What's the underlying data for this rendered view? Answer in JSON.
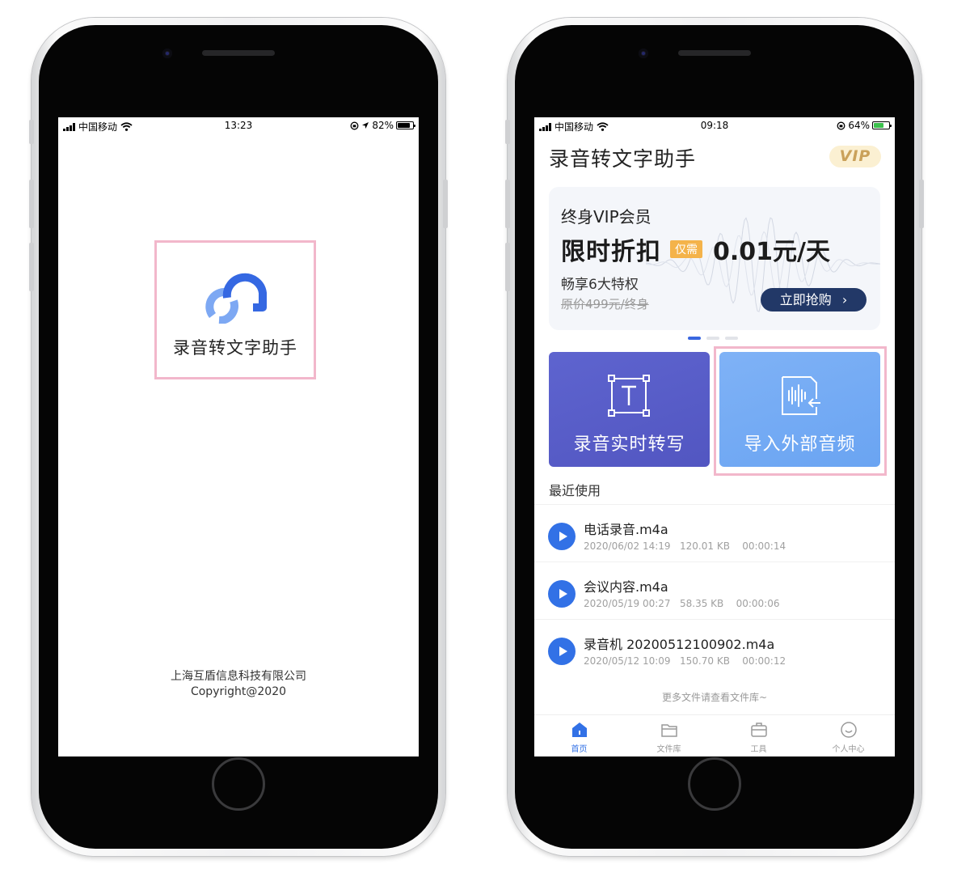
{
  "left_screen": {
    "status": {
      "carrier": "中国移动",
      "time": "13:23",
      "battery": "82%",
      "battery_level": 0.82
    },
    "app_name": "录音转文字助手",
    "company": "上海互盾信息科技有限公司",
    "copyright": "Copyright@2020"
  },
  "right_screen": {
    "status": {
      "carrier": "中国移动",
      "time": "09:18",
      "battery": "64%",
      "battery_level": 0.64
    },
    "header": {
      "title": "录音转文字助手",
      "vip_badge": "VIP"
    },
    "banner": {
      "title": "终身VIP会员",
      "discount": "限时折扣",
      "tag": "仅需",
      "price": "0.01元/天",
      "subtitle": "畅享6大特权",
      "original_price": "原价499元/终身",
      "buy_button": "立即抢购"
    },
    "carousel": {
      "total": 3,
      "active_index": 0
    },
    "cards": {
      "realtime": "录音实时转写",
      "import": "导入外部音频"
    },
    "recent": {
      "title": "最近使用",
      "items": [
        {
          "name": "电话录音.m4a",
          "date": "2020/06/02 14:19",
          "size": "120.01 KB",
          "duration": "00:00:14"
        },
        {
          "name": "会议内容.m4a",
          "date": "2020/05/19 00:27",
          "size": "58.35 KB",
          "duration": "00:00:06"
        },
        {
          "name": "录音机 20200512100902.m4a",
          "date": "2020/05/12 10:09",
          "size": "150.70 KB",
          "duration": "00:00:12"
        }
      ],
      "more": "更多文件请查看文件库~"
    },
    "tabs": [
      {
        "label": "首页",
        "icon": "home-icon",
        "active": true
      },
      {
        "label": "文件库",
        "icon": "folder-icon",
        "active": false
      },
      {
        "label": "工具",
        "icon": "toolbox-icon",
        "active": false
      },
      {
        "label": "个人中心",
        "icon": "smile-icon",
        "active": false
      }
    ]
  },
  "colors": {
    "accent": "#3271e6",
    "card_realtime": "#5a5fc9",
    "card_import": "#76acf4",
    "highlight": "#f2b7cb",
    "vip_gold": "#caa15a",
    "tag_orange": "#f4b34a",
    "buy_button": "#223867"
  }
}
